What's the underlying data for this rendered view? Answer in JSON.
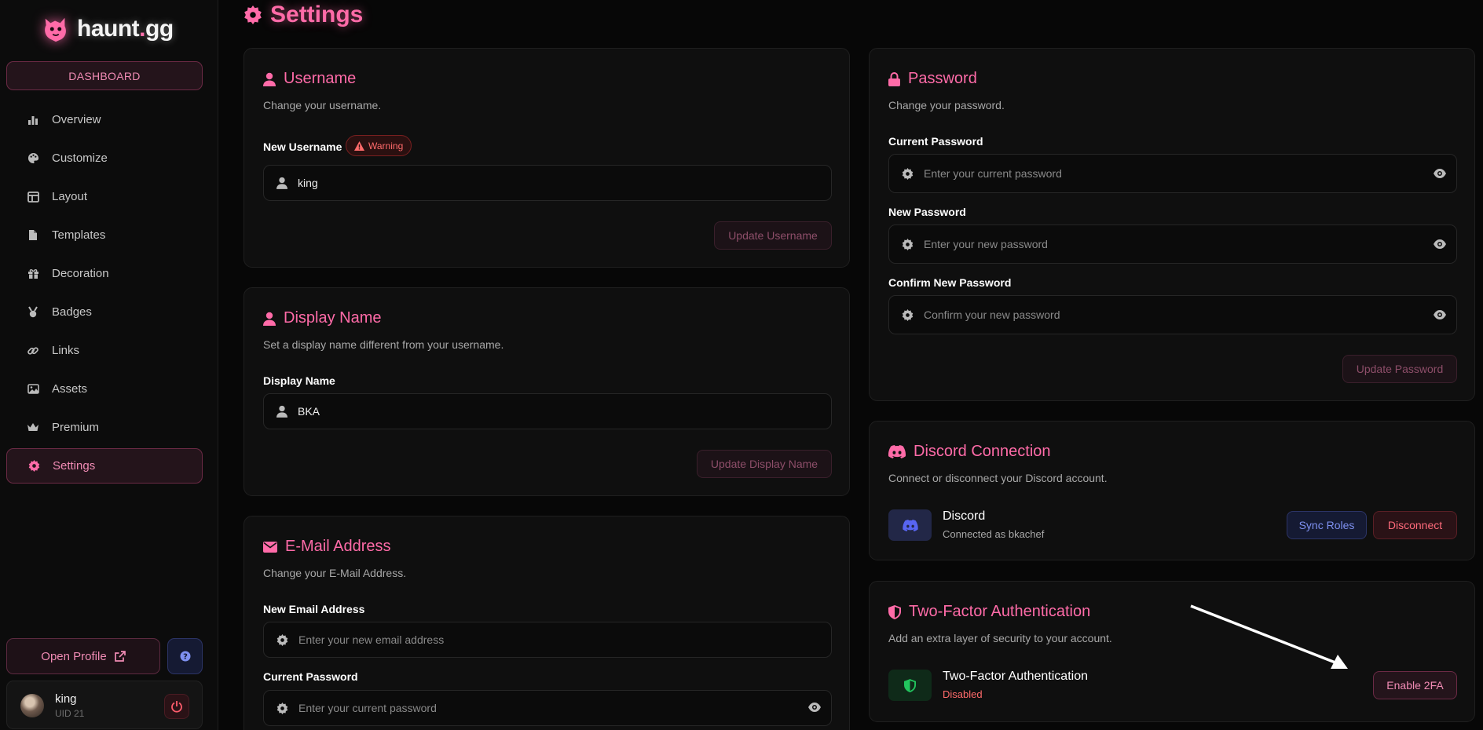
{
  "brand": {
    "name": "haunt",
    "dot": ".",
    "tld": "gg"
  },
  "sidebar": {
    "dashboard_label": "DASHBOARD",
    "items": [
      {
        "label": "Overview",
        "icon": "bar-chart-icon"
      },
      {
        "label": "Customize",
        "icon": "palette-icon"
      },
      {
        "label": "Layout",
        "icon": "layout-icon"
      },
      {
        "label": "Templates",
        "icon": "file-icon"
      },
      {
        "label": "Decoration",
        "icon": "gift-icon"
      },
      {
        "label": "Badges",
        "icon": "medal-icon"
      },
      {
        "label": "Links",
        "icon": "link-icon"
      },
      {
        "label": "Assets",
        "icon": "image-icon"
      },
      {
        "label": "Premium",
        "icon": "crown-icon"
      },
      {
        "label": "Settings",
        "icon": "gear-icon",
        "active": true
      }
    ],
    "open_profile_label": "Open Profile",
    "user": {
      "name": "king",
      "uid": "UID 21"
    }
  },
  "page": {
    "title": "Settings"
  },
  "username_card": {
    "title": "Username",
    "desc": "Change your username.",
    "field_label": "New Username",
    "warning_label": "Warning",
    "value": "king",
    "button": "Update Username"
  },
  "display_card": {
    "title": "Display Name",
    "desc": "Set a display name different from your username.",
    "field_label": "Display Name",
    "value": "BKA",
    "button": "Update Display Name"
  },
  "email_card": {
    "title": "E-Mail Address",
    "desc": "Change your E-Mail Address.",
    "email_label": "New Email Address",
    "email_placeholder": "Enter your new email address",
    "password_label": "Current Password",
    "password_placeholder": "Enter your current password"
  },
  "password_card": {
    "title": "Password",
    "desc": "Change your password.",
    "current_label": "Current Password",
    "current_placeholder": "Enter your current password",
    "new_label": "New Password",
    "new_placeholder": "Enter your new password",
    "confirm_label": "Confirm New Password",
    "confirm_placeholder": "Confirm your new password",
    "button": "Update Password"
  },
  "discord_card": {
    "title": "Discord Connection",
    "desc": "Connect or disconnect your Discord account.",
    "service": "Discord",
    "status": "Connected as bkachef",
    "sync_button": "Sync Roles",
    "disconnect_button": "Disconnect"
  },
  "twofa_card": {
    "title": "Two-Factor Authentication",
    "desc": "Add an extra layer of security to your account.",
    "service": "Two-Factor Authentication",
    "status": "Disabled",
    "button": "Enable 2FA"
  },
  "colors": {
    "accent": "#ff6ba8",
    "background": "#070707",
    "card": "#0f0f0f",
    "discord": "#5865f2",
    "success": "#22c55e",
    "danger": "#ff6b6b"
  }
}
